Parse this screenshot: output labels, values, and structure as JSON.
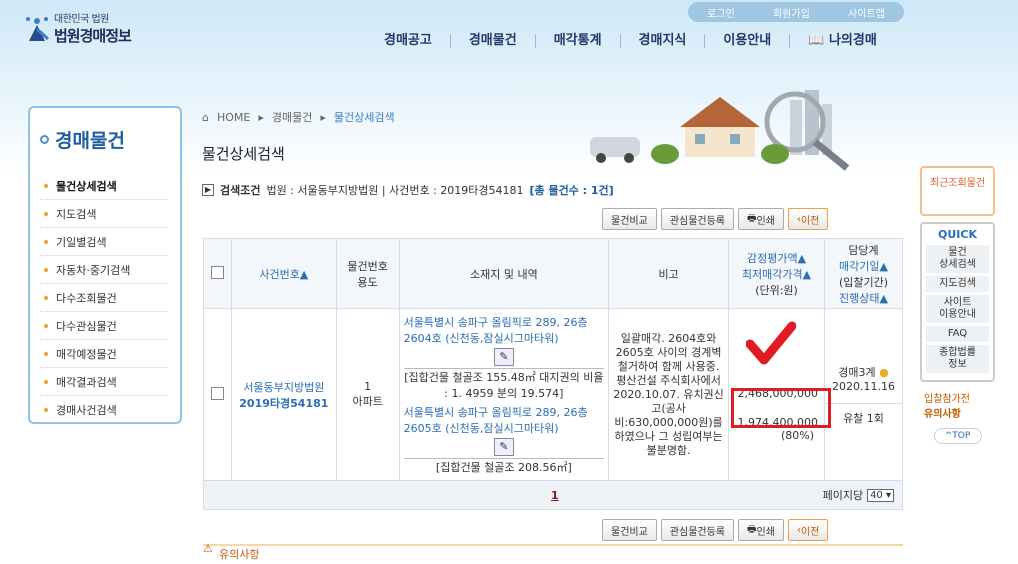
{
  "header": {
    "logo_line1": "대한민국 법원",
    "logo_line2": "법원경매정보",
    "util": [
      "로그인",
      "회원가입",
      "사이트맵"
    ],
    "nav": [
      "경매공고",
      "경매물건",
      "매각통계",
      "경매지식",
      "이용안내",
      "나의경매"
    ]
  },
  "lnb": {
    "title": "경매물건",
    "items": [
      "물건상세검색",
      "지도검색",
      "기일별검색",
      "자동차·중기검색",
      "다수조회물건",
      "다수관심물건",
      "매각예정물건",
      "매각결과검색",
      "경매사건검색"
    ]
  },
  "breadcrumb": [
    "HOME",
    "경매물건",
    "물건상세검색"
  ],
  "page_title": "물건상세검색",
  "condition": {
    "label": "검색조건",
    "text": "법원 : 서울동부지방법원 | 사건번호 : 2019타경54181",
    "count": "[총 물건수 : 1건]"
  },
  "buttons": {
    "compare": "물건비교",
    "interest": "관심물건등록",
    "print": "인쇄",
    "prev": "이전"
  },
  "table": {
    "headers": {
      "case": "사건번호",
      "item_no": "물건번호",
      "usage": "용도",
      "location": "소재지 및 내역",
      "remark": "비고",
      "appraisal": "감정평가액",
      "min_price": "최저매각가격",
      "unit": "(단위:원)",
      "dept": "담당계",
      "sale_date": "매각기일",
      "period": "(입찰기간)",
      "status": "진행상태"
    },
    "row": {
      "case_court": "서울동부지방법원",
      "case_no": "2019타경54181",
      "item_no": "1",
      "usage": "아파트",
      "addr1": "서울특별시 송파구 올림픽로 289, 26층2604호 (신천동,잠실시그마타워)",
      "detail1": "[집합건물 철골조 155.48㎡ 대지권의 비율 : 1. 4959 분의 19.574]",
      "addr2": "서울특별시 송파구 올림픽로 289, 26층2605호 (신천동,잠실시그마타워)",
      "detail2": "[집합건물 철골조 208.56㎡]",
      "remark": "일괄매각. 2604호와 2605호 사이의 경계벽 철거하여 함께 사용중. 평산건설 주식회사에서 2020.10.07. 유치권신고(공사비:630,000,000원)를 하였으나 그 성립여부는 불분명함.",
      "appraisal": "2,468,000,000",
      "min_price": "1,974,400,000",
      "min_pct": "(80%)",
      "dept": "경매3계",
      "sale_date": "2020.11.16",
      "status": "유찰 1회"
    }
  },
  "pager": {
    "current": "1",
    "per_page_label": "페이지당",
    "per_page": "40"
  },
  "warning": "유의사항",
  "quick": {
    "recent": "최근조회물건",
    "title": "QUICK",
    "items": [
      "물건\n상세검색",
      "지도검색",
      "사이트\n이용안내",
      "FAQ",
      "종합법률\n정보"
    ],
    "notice1": "입찰참가전",
    "notice2": "유의사항",
    "top": "TOP"
  },
  "colors": {
    "accent": "#1f5e9e",
    "highlight": "#e01b24"
  }
}
